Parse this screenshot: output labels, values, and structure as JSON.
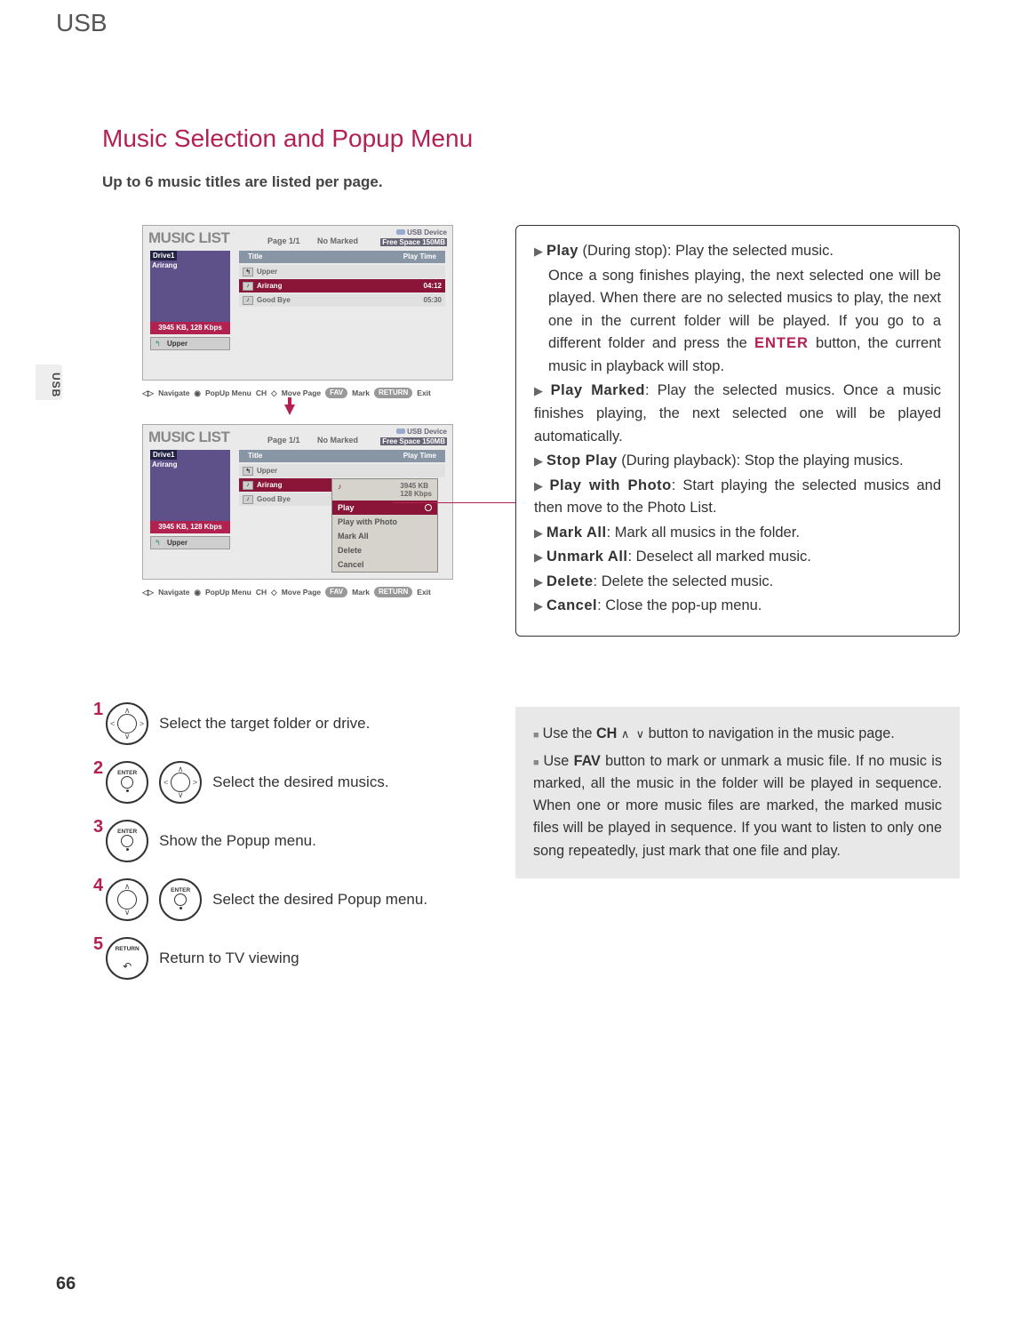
{
  "header": {
    "section": "USB",
    "sidebar": "USB"
  },
  "title": "Music Selection and Popup Menu",
  "subtitle": "Up to 6 music titles are listed per page.",
  "music_list": {
    "heading": "MUSIC LIST",
    "pageinfo": "Page 1/1",
    "no_marked": "No Marked",
    "usb_label": "USB Device",
    "free_space": "Free Space 150MB",
    "drive_label": "Drive1",
    "thumb_name": "Arirang",
    "size_info": "3945 KB, 128 Kbps",
    "upper_btn": "Upper",
    "col_title": "Title",
    "col_playtime": "Play Time",
    "rows": {
      "upper": "Upper",
      "r1_title": "Arirang",
      "r1_time": "04:12",
      "r2_title": "Good Bye",
      "r2_time": "05:30",
      "popup_r1_title": "Arirang",
      "popup_r2_title": "Good Bye"
    },
    "popup": {
      "size_line": "3945 KB\n128 Kbps",
      "size_a": "3945 KB",
      "size_b": "128 Kbps",
      "items": {
        "play": "Play",
        "play_with_photo": "Play with Photo",
        "mark_all": "Mark All",
        "delete": "Delete",
        "cancel": "Cancel"
      }
    }
  },
  "navbar": {
    "navigate": "Navigate",
    "popup": "PopUp Menu",
    "ch": "CH",
    "move_page": "Move Page",
    "fav": "FAV",
    "mark": "Mark",
    "return": "RETURN",
    "exit": "Exit"
  },
  "descriptions": {
    "play_label": "Play",
    "play_text_a": " (During stop): Play the selected music.",
    "play_text_b": "Once a song finishes playing, the next selected one will be played. When there are no selected musics to play, the next one in the current folder will be played. If you go to a different folder and press the ",
    "enter": "ENTER",
    "play_text_c": " button, the current music in playback will stop.",
    "play_marked_label": "Play Marked",
    "play_marked_text": ": Play the selected musics. Once a music finishes playing, the next selected one will be played automatically.",
    "stop_play_label": "Stop Play",
    "stop_play_text": " (During playback): Stop the playing musics.",
    "play_with_photo_label": "Play with Photo",
    "play_with_photo_text": ": Start playing the selected musics and then move to the Photo List.",
    "mark_all_label": "Mark All",
    "mark_all_text": ": Mark all musics in the folder.",
    "unmark_all_label": "Unmark All",
    "unmark_all_text": ": Deselect all marked music.",
    "delete_label": "Delete",
    "delete_text": ": Delete the selected music.",
    "cancel_label": "Cancel",
    "cancel_text": ": Close the pop-up menu."
  },
  "steps": {
    "s1": "Select the target folder or drive.",
    "s2": "Select the desired musics.",
    "s3": "Show the Popup menu.",
    "s4": "Select the desired Popup menu.",
    "s5": "Return to TV viewing",
    "n1": "1",
    "n2": "2",
    "n3": "3",
    "n4": "4",
    "n5": "5",
    "enter_label": "ENTER",
    "return_label": "RETURN"
  },
  "tips": {
    "t1a": "Use the ",
    "ch": "CH",
    "t1b": " button to navigation in the music page.",
    "t2a": "Use ",
    "fav": "FAV",
    "t2b": " button to mark or unmark a music file. If no music is marked, all the music in the folder will be played in sequence. When one or more music files are marked, the marked music files will be played in sequence. If you want to listen to only one song repeatedly, just mark that one file and play."
  },
  "page_number": "66"
}
